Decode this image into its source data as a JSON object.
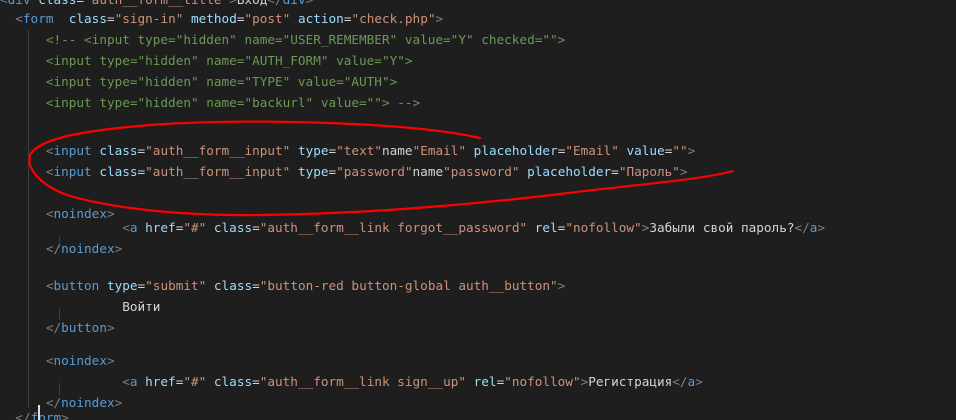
{
  "code_lines": [
    {
      "indent": "",
      "text": "<div class=\"auth__form__title\">Вход</div>"
    },
    {
      "indent": "",
      "text": "<form  class=\"sign-in\" method=\"post\" action=\"check.php\">"
    },
    {
      "indent": "    ",
      "text": "<!-- <input type=\"hidden\" name=\"USER_REMEMBER\" value=\"Y\" checked=\"\">"
    },
    {
      "indent": "    ",
      "text": "<input type=\"hidden\" name=\"AUTH_FORM\" value=\"Y\">"
    },
    {
      "indent": "    ",
      "text": "<input type=\"hidden\" name=\"TYPE\" value=\"AUTH\">"
    },
    {
      "indent": "    ",
      "text": "<input type=\"hidden\" name=\"backurl\" value=\"\"> -->"
    },
    {
      "indent": "",
      "text": ""
    },
    {
      "indent": "",
      "text": ""
    },
    {
      "indent": "    ",
      "text": "<input class=\"auth__form__input\" type=\"text\"name=\"Email\" placeholder=\"Email\" value=\"\">"
    },
    {
      "indent": "    ",
      "text": "<input class=\"auth__form__input\" type=\"password\"name=\"password\" placeholder=\"Пароль\">"
    },
    {
      "indent": "    ",
      "text": "<noindex>"
    },
    {
      "indent": "        ",
      "text": "<a href=\"#\" class=\"auth__form__link forgot__password\" rel=\"nofollow\">Забыли свой пароль?</a>"
    },
    {
      "indent": "    ",
      "text": "</noindex>"
    },
    {
      "indent": "    ",
      "text": "<button type=\"submit\" class=\"button-red button-global auth__button\">"
    },
    {
      "indent": "        ",
      "text": "Войти"
    },
    {
      "indent": "    ",
      "text": "</button>"
    },
    {
      "indent": "    ",
      "text": "<noindex>"
    },
    {
      "indent": "        ",
      "text": "<a href=\"#\" class=\"auth__form__link sign__up\" rel=\"nofollow\">Регистрация</a>"
    },
    {
      "indent": "    ",
      "text": "</noindex>"
    },
    {
      "indent": "",
      "text": "</form>"
    }
  ],
  "colors": {
    "background": "#1e1e1e",
    "tag": "#569cd6",
    "attribute": "#9cdcfe",
    "string": "#ce9178",
    "comment": "#6a9955",
    "text": "#d4d4d4",
    "punctuation": "#808080",
    "annotation": "#ff0000"
  },
  "icons": {
    "annotation": "red-freehand-ellipse-annotation",
    "cursor": "text-cursor-icon"
  }
}
